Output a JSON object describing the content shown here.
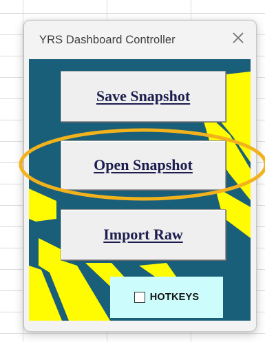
{
  "window": {
    "title": "YRS Dashboard Controller",
    "close_icon": "close-icon"
  },
  "buttons": {
    "save_snapshot": "Save Snapshot",
    "open_snapshot": "Open Snapshot",
    "import_raw": "Import Raw"
  },
  "hotkeys": {
    "label": "HOTKEYS",
    "checked": false
  },
  "colors": {
    "panel_background": "#1a5f7a",
    "panel_pattern": "#fffb00",
    "hotkeys_background": "#ccfcfc",
    "button_text": "#1c1c4e",
    "highlight_ellipse": "#f2b21c"
  }
}
